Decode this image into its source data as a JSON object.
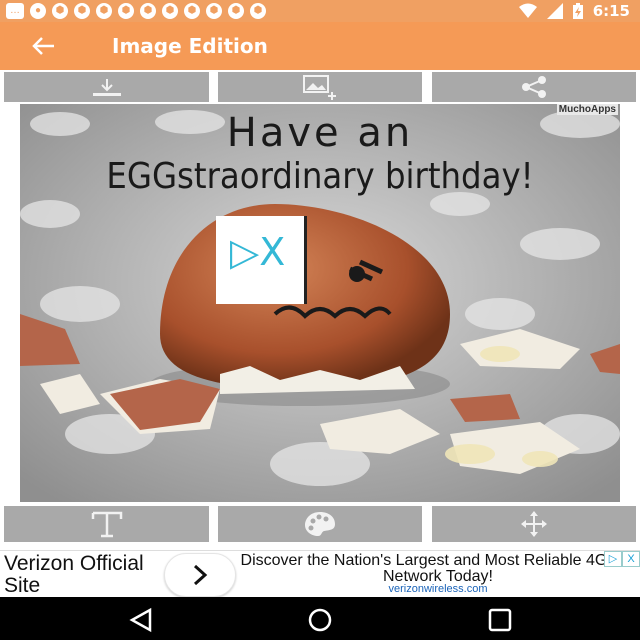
{
  "status_bar": {
    "time": "6:15",
    "notification_icons": [
      "message-icon",
      "app-icon",
      "soccer-ball-icon",
      "soccer-ball-icon",
      "soccer-ball-icon",
      "soccer-ball-icon",
      "soccer-ball-icon",
      "soccer-ball-icon",
      "soccer-ball-icon",
      "soccer-ball-icon",
      "soccer-ball-icon",
      "soccer-ball-icon",
      "soccer-ball-icon"
    ],
    "right_icons": [
      "wifi-icon",
      "signal-icon",
      "battery-charging-icon"
    ]
  },
  "app_bar": {
    "title": "Image Edition",
    "back_icon": "arrow-left-icon",
    "color": "#f59a56"
  },
  "top_toolbar": [
    {
      "name": "download-button",
      "icon": "download-icon"
    },
    {
      "name": "add-image-button",
      "icon": "image-add-icon"
    },
    {
      "name": "share-button",
      "icon": "share-icon"
    }
  ],
  "image": {
    "watermark": "MuchoApps",
    "line1": "Have an",
    "line2": "EGGstraordinary birthday!",
    "sticker_text": "▷X"
  },
  "bottom_toolbar": [
    {
      "name": "text-tool-button",
      "icon": "text-icon"
    },
    {
      "name": "palette-tool-button",
      "icon": "palette-icon"
    },
    {
      "name": "move-tool-button",
      "icon": "move-icon"
    }
  ],
  "ad": {
    "title": "Verizon Official Site",
    "headline": "Discover the Nation's Largest and Most Reliable 4GLTE Network Today!",
    "url": "verizonwireless.com",
    "adchoices_icon": "adchoices-icon",
    "close_label": "X"
  },
  "nav_bar": [
    "back-nav-icon",
    "home-nav-icon",
    "recents-nav-icon"
  ]
}
